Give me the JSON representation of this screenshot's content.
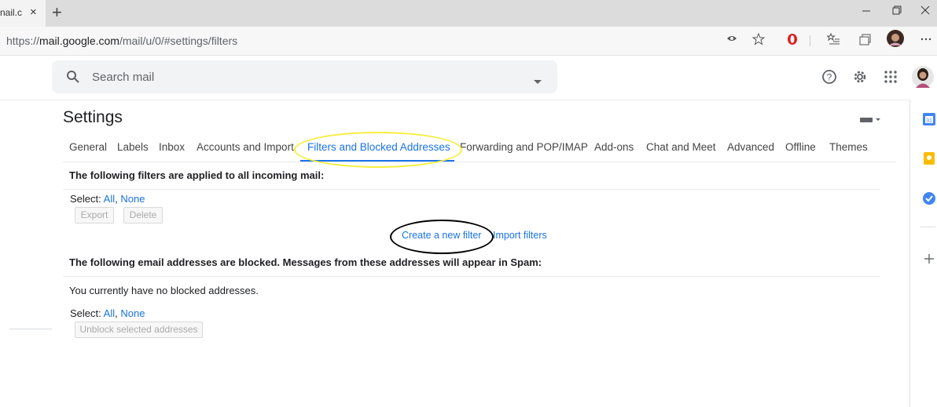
{
  "browser": {
    "tab_title": "nail.c",
    "tab_close": "×",
    "new_tab": "+",
    "url_prefix": "https://",
    "url_host": "mail.google.com",
    "url_path": "/mail/u/0/#settings/filters",
    "window_controls": [
      "minimize-icon",
      "restore-icon",
      "close-icon"
    ]
  },
  "search": {
    "placeholder": "Search mail"
  },
  "settings": {
    "title": "Settings",
    "tabs": [
      "General",
      "Labels",
      "Inbox",
      "Accounts and Import",
      "Filters and Blocked Addresses",
      "Forwarding and POP/IMAP",
      "Add-ons",
      "Chat and Meet",
      "Advanced",
      "Offline",
      "Themes"
    ],
    "active_tab": "Filters and Blocked Addresses"
  },
  "filters": {
    "heading": "The following filters are applied to all incoming mail:",
    "select_label": "Select:",
    "select_all": "All",
    "select_sep": ",",
    "select_none": "None",
    "export_label": "Export",
    "delete_label": "Delete",
    "create_filter": "Create a new filter",
    "import_filters": "Import filters"
  },
  "blocked": {
    "heading": "The following email addresses are blocked. Messages from these addresses will appear in Spam:",
    "empty_message": "You currently have no blocked addresses.",
    "select_label": "Select:",
    "select_all": "All",
    "select_sep": ",",
    "select_none": "None",
    "unblock_label": "Unblock selected addresses"
  },
  "colors": {
    "accent": "#1a73e8",
    "highlight_yellow": "#f7ee3a",
    "highlight_black": "#000000"
  }
}
